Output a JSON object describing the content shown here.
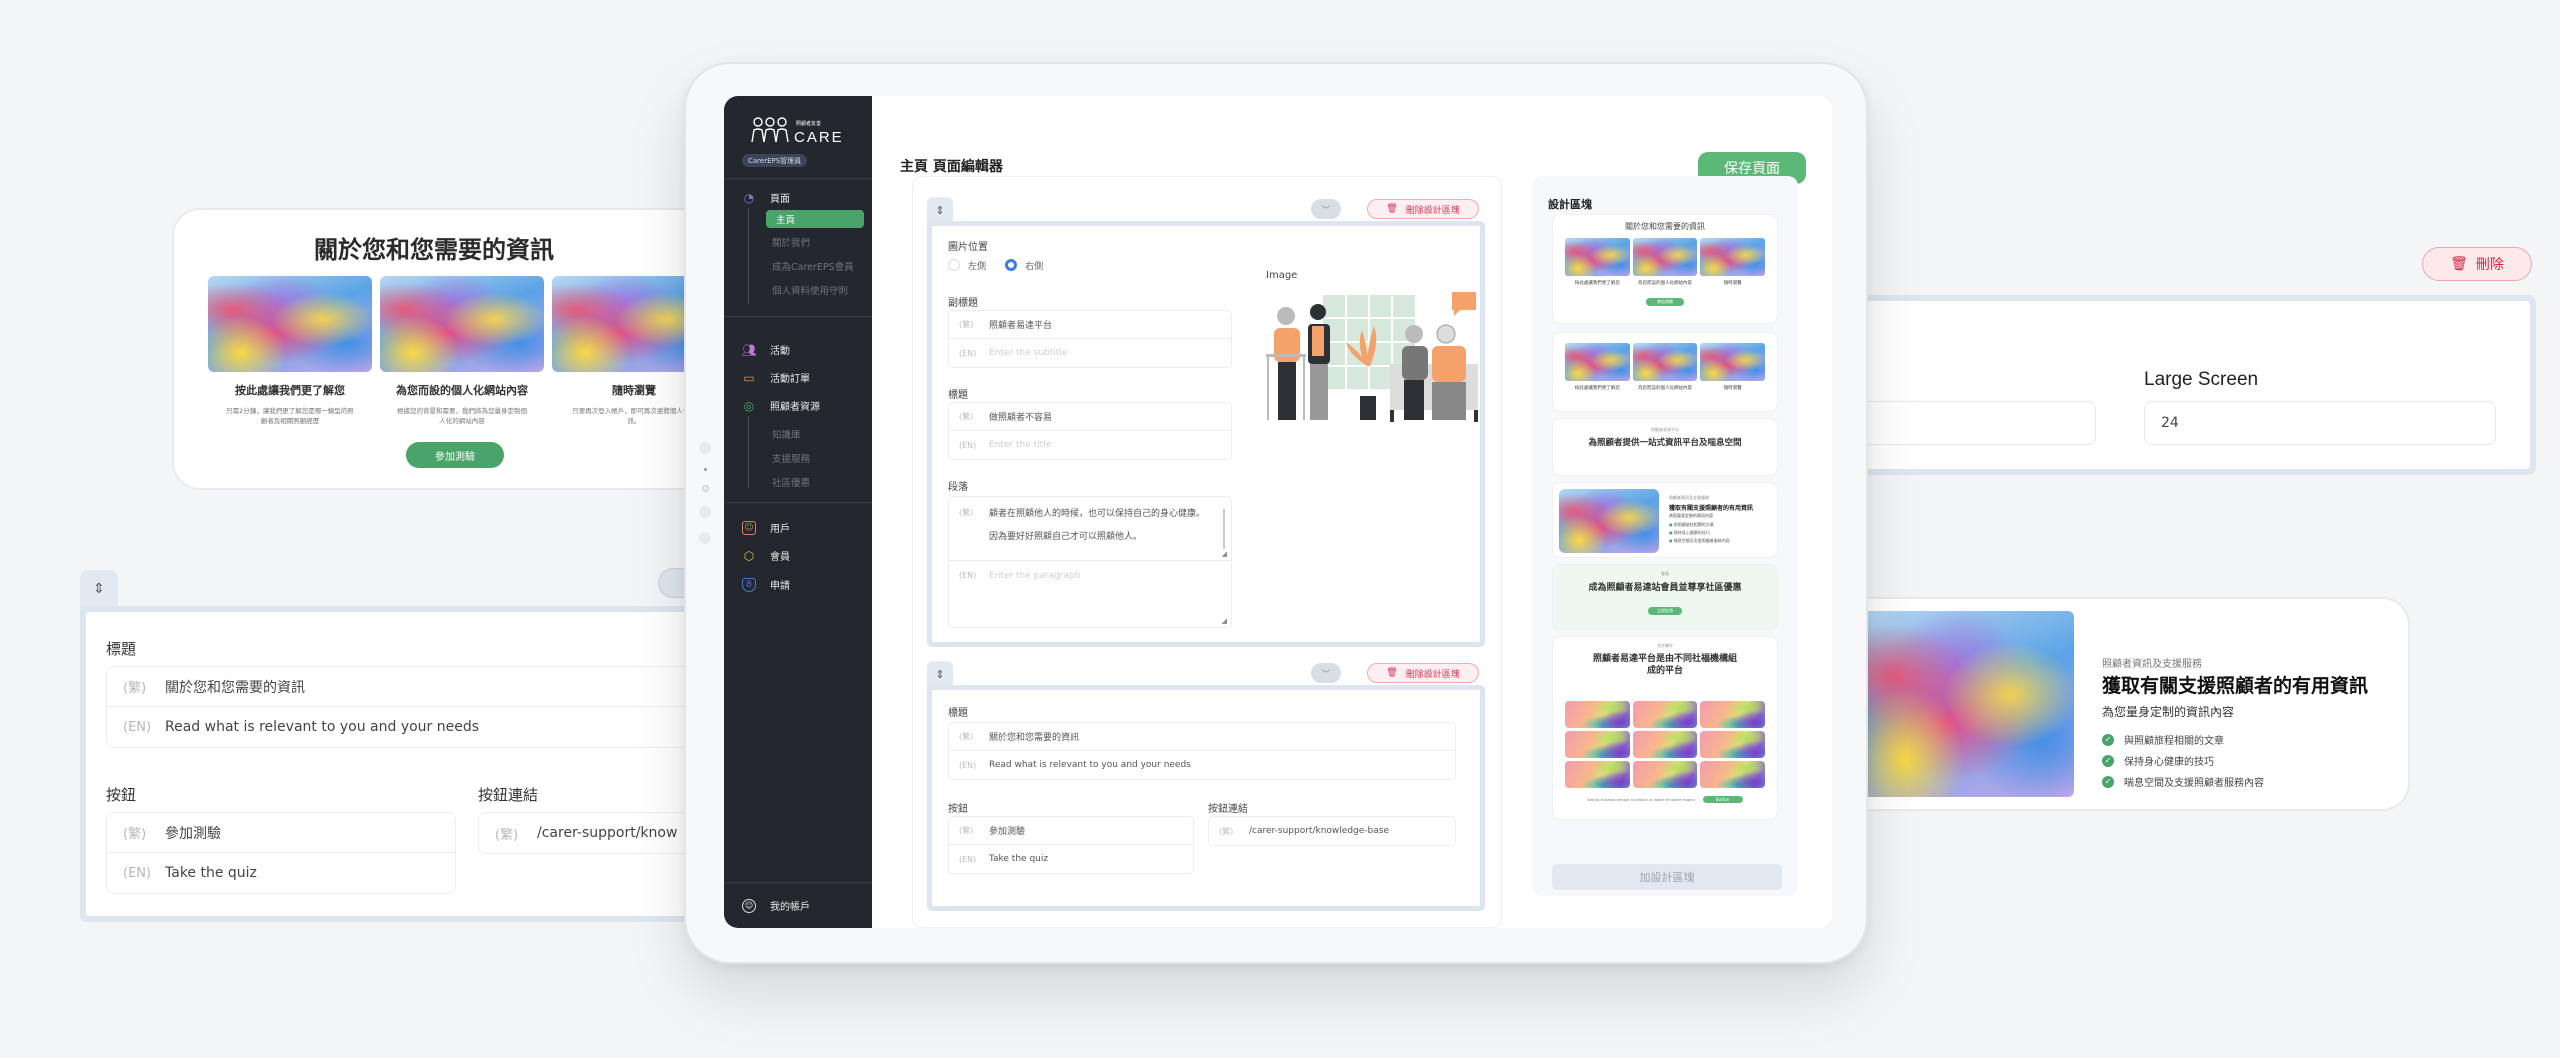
{
  "colors": {
    "brand_green": "#49a46a",
    "save_green": "#5bb877",
    "danger_red": "#d6374e",
    "sidebar_bg": "#24282e",
    "frame_blue": "#dde5ef",
    "radio_blue": "#3b7de0"
  },
  "sidebar": {
    "logo_text": "CARE",
    "logo_subtext": "照顧者友善",
    "role_badge": "CarerEPS管理員",
    "groups": [
      {
        "label": "頁面",
        "icon": "pages-icon",
        "icon_color": "#8a6fd8",
        "children": [
          "主頁",
          "關於我們",
          "成為CarerEPS會員",
          "個人資料使用守則"
        ],
        "active_child": "主頁"
      },
      {
        "label": "活動",
        "icon": "activity-users-icon",
        "icon_color": "#c178d8"
      },
      {
        "label": "活動訂單",
        "icon": "ticket-icon",
        "icon_color": "#e3944a"
      },
      {
        "label": "照顧者資源",
        "icon": "resource-icon",
        "icon_color": "#4fb06e",
        "children": [
          "知識庫",
          "支援服務",
          "社區優惠"
        ]
      },
      {
        "label": "用戶",
        "icon": "user-icon",
        "icon_color": "#e07a5f"
      },
      {
        "label": "會員",
        "icon": "member-icon",
        "icon_color": "#e2c43b"
      },
      {
        "label": "申請",
        "icon": "application-icon",
        "icon_color": "#3b7de0"
      }
    ],
    "account_label": "我的帳戶"
  },
  "header": {
    "title": "主頁 頁面編輯器",
    "save_label": "保存頁面"
  },
  "editor": {
    "delete_block_label": "刪除設計區塊",
    "lang_zh": "(繁)",
    "lang_en": "(EN)",
    "block1": {
      "image_position_label": "圖片位置",
      "options": [
        "左側",
        "右側"
      ],
      "selected": "右側",
      "subtitle_label": "副標題",
      "subtitle_zh": "照顧者易達平台",
      "subtitle_en_placeholder": "Enter the subtitle",
      "title_label": "標題",
      "title_zh": "做照顧者不容易",
      "title_en_placeholder": "Enter the title",
      "paragraph_label": "段落",
      "paragraph_zh_line1": "顧者在照顧他人的時候，也可以保持自己的身心健康。",
      "paragraph_zh_line2": "因為要好好照顧自己才可以照顧他人。",
      "paragraph_en_placeholder": "Enter the paragraph",
      "image_label": "Image"
    },
    "block2": {
      "title_label": "標題",
      "title_zh": "關於您和您需要的資訊",
      "title_en": "Read what is relevant to you and your needs",
      "button_label": "按鈕",
      "button_zh": "參加測驗",
      "button_en": "Take the quiz",
      "button_link_label": "按鈕連結",
      "button_link": "/carer-support/knowledge-base"
    }
  },
  "design_panel": {
    "title": "設計區塊",
    "add_label": "加設計區塊",
    "previews": [
      {
        "type": "three-features",
        "title": "關於您和您需要的資訊",
        "items": [
          "按此處讓我們更了解您",
          "為您而設的個人化網站內容",
          "隨時瀏覽"
        ],
        "button": "參加測驗"
      },
      {
        "type": "three-features-no-title",
        "items": [
          "按此處讓我們更了解您",
          "為您而設的個人化網站內容",
          "隨時瀏覽"
        ]
      },
      {
        "type": "hero-text",
        "kicker": "照顧者易達平台",
        "title": "為照顧者提供一站式資訊平台及喘息空間"
      },
      {
        "type": "image-list",
        "kicker": "照顧者資訊及支援服務",
        "title": "獲取有關支援照顧者的有用資訊",
        "subtitle": "為您量身定制的資訊內容",
        "bullets": [
          "與照顧旅程相關的文章",
          "保持身心健康的技巧",
          "喘息空間及支援照顧者服務內容"
        ]
      },
      {
        "type": "cta",
        "kicker": "會員",
        "title": "成為照顧者易達站會員並尊享社區優惠",
        "button": "立即註冊"
      },
      {
        "type": "logo-grid",
        "kicker": "合作夥伴",
        "title": "照顧者易達平台是由不同社福機構組成的平台",
        "footer_text": "Sed do eiusmod tempor incididunt ut labore et dolore magna",
        "button": "Button"
      }
    ]
  },
  "floating": {
    "preview_card": {
      "title": "關於您和您需要的資訊",
      "features": [
        {
          "title": "按此處讓我們更了解您",
          "desc": "只需2分鐘，讓我們更了解您是哪一類型的照顧者及相關照顧經歷"
        },
        {
          "title": "為您而設的個人化網站內容",
          "desc": "根據您的背景和需要，我們將為您量身定制個人化的網站內容"
        },
        {
          "title": "隨時瀏覽",
          "desc": "只要再次登入帳戶，即可再次瀏覽個人化資訊。"
        }
      ],
      "button": "參加測驗"
    },
    "editor_card": {
      "title_label": "標題",
      "title_zh": "關於您和您需要的資訊",
      "title_en": "Read what is relevant to you and your needs",
      "button_label": "按鈕",
      "button_zh": "參加測驗",
      "button_en": "Take the quiz",
      "button_link_label": "按鈕連結",
      "button_link": "/carer-support/know"
    },
    "size_card": {
      "delete_label": "刪除",
      "large_screen_label": "Large Screen",
      "large_screen_value": "24"
    },
    "feature_card": {
      "kicker": "照顧者資訊及支援服務",
      "title": "獲取有關支援照顧者的有用資訊",
      "subtitle": "為您量身定制的資訊內容",
      "bullets": [
        "與照顧旅程相關的文章",
        "保持身心健康的技巧",
        "喘息空間及支援照顧者服務內容"
      ]
    }
  }
}
